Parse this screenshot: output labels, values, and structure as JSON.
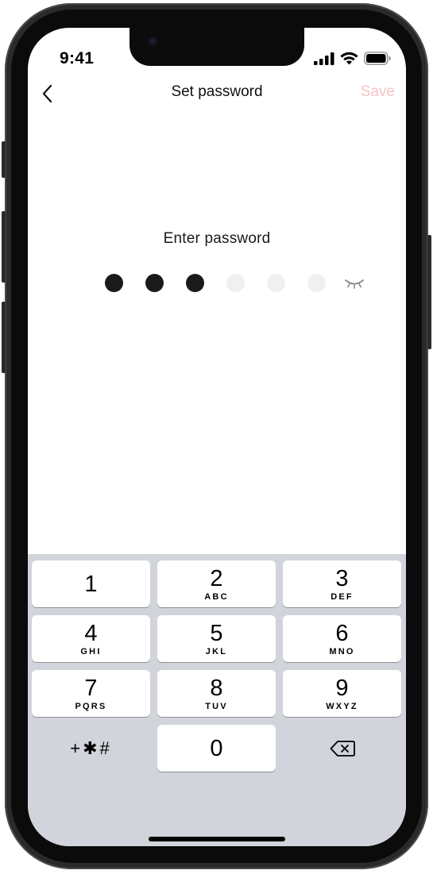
{
  "status_bar": {
    "time": "9:41"
  },
  "nav": {
    "title": "Set password",
    "save_label": "Save"
  },
  "prompt": {
    "text": "Enter password"
  },
  "password": {
    "length": 6,
    "entered": 3
  },
  "keypad": {
    "keys": [
      {
        "num": "1",
        "letters": ""
      },
      {
        "num": "2",
        "letters": "ABC"
      },
      {
        "num": "3",
        "letters": "DEF"
      },
      {
        "num": "4",
        "letters": "GHI"
      },
      {
        "num": "5",
        "letters": "JKL"
      },
      {
        "num": "6",
        "letters": "MNO"
      },
      {
        "num": "7",
        "letters": "PQRS"
      },
      {
        "num": "8",
        "letters": "TUV"
      },
      {
        "num": "9",
        "letters": "WXYZ"
      },
      {
        "num": "0",
        "letters": ""
      }
    ],
    "symbols": "+✱#"
  },
  "colors": {
    "save_disabled": "#f7c3c6",
    "keyboard_bg": "#d1d4da"
  },
  "icons": [
    "back-chevron-icon",
    "signal-icon",
    "wifi-icon",
    "battery-icon",
    "eye-closed-icon",
    "backspace-icon"
  ]
}
